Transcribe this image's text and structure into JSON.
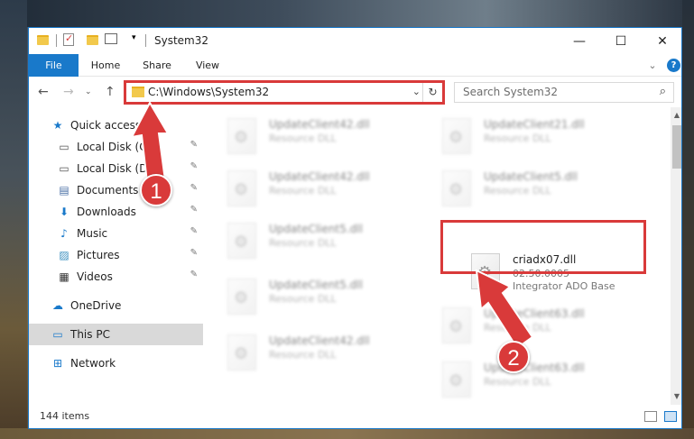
{
  "window": {
    "title": "System32",
    "minimize_glyph": "—",
    "maximize_glyph": "☐",
    "close_glyph": "✕"
  },
  "ribbon": {
    "tabs": [
      "File",
      "Home",
      "Share",
      "View"
    ],
    "expand_glyph": "⌄",
    "help_glyph": "?"
  },
  "nav": {
    "back_glyph": "←",
    "forward_glyph": "→",
    "recent_glyph": "⌄",
    "up_glyph": "↑",
    "address": "C:\\Windows\\System32",
    "address_dropdown_glyph": "⌄",
    "refresh_glyph": "↻",
    "search_placeholder": "Search System32",
    "search_glyph": "⌕"
  },
  "sidebar": {
    "items": [
      {
        "label": "Quick access",
        "icon": "star-icon",
        "glyph": "★"
      },
      {
        "label": "Local Disk (C:)",
        "icon": "drive-icon",
        "glyph": "▭"
      },
      {
        "label": "Local Disk (D:)",
        "icon": "drive-icon",
        "glyph": "▭"
      },
      {
        "label": "Documents",
        "icon": "document-icon",
        "glyph": "▤"
      },
      {
        "label": "Downloads",
        "icon": "download-icon",
        "glyph": "⬇"
      },
      {
        "label": "Music",
        "icon": "music-icon",
        "glyph": "♪"
      },
      {
        "label": "Pictures",
        "icon": "pictures-icon",
        "glyph": "▨"
      },
      {
        "label": "Videos",
        "icon": "video-icon",
        "glyph": "▦"
      },
      {
        "label": "OneDrive",
        "icon": "cloud-icon",
        "glyph": "☁"
      },
      {
        "label": "This PC",
        "icon": "computer-icon",
        "glyph": "▭"
      },
      {
        "label": "Network",
        "icon": "network-icon",
        "glyph": "⊞"
      }
    ],
    "pin_glyph": "📌"
  },
  "files": [
    {
      "name": "UpdateClient42.dll",
      "version": "",
      "desc": "Resource DLL"
    },
    {
      "name": "UpdateClient21.dll",
      "version": "",
      "desc": "Resource DLL"
    },
    {
      "name": "UpdateClient42.dll",
      "version": "",
      "desc": "Resource DLL"
    },
    {
      "name": "UpdateClient5.dll",
      "version": "",
      "desc": "Resource DLL"
    },
    {
      "name": "UpdateClient5.dll",
      "version": "",
      "desc": "Resource DLL"
    },
    {
      "name": "criadx07.dll",
      "version": "02.50.0005",
      "desc": "Integrator ADO Base"
    },
    {
      "name": "UpdateClient5.dll",
      "version": "",
      "desc": "Resource DLL"
    },
    {
      "name": "UpdateClient63.dll",
      "version": "",
      "desc": "Resource DLL"
    },
    {
      "name": "UpdateClient42.dll",
      "version": "",
      "desc": "Resource DLL"
    },
    {
      "name": "UpdateClient63.dll",
      "version": "",
      "desc": "Resource DLL"
    }
  ],
  "status": {
    "item_count": "144 items"
  },
  "annotations": {
    "step1": "1",
    "step2": "2"
  },
  "colors": {
    "accent": "#1979ca",
    "highlight": "#d93a3a"
  }
}
